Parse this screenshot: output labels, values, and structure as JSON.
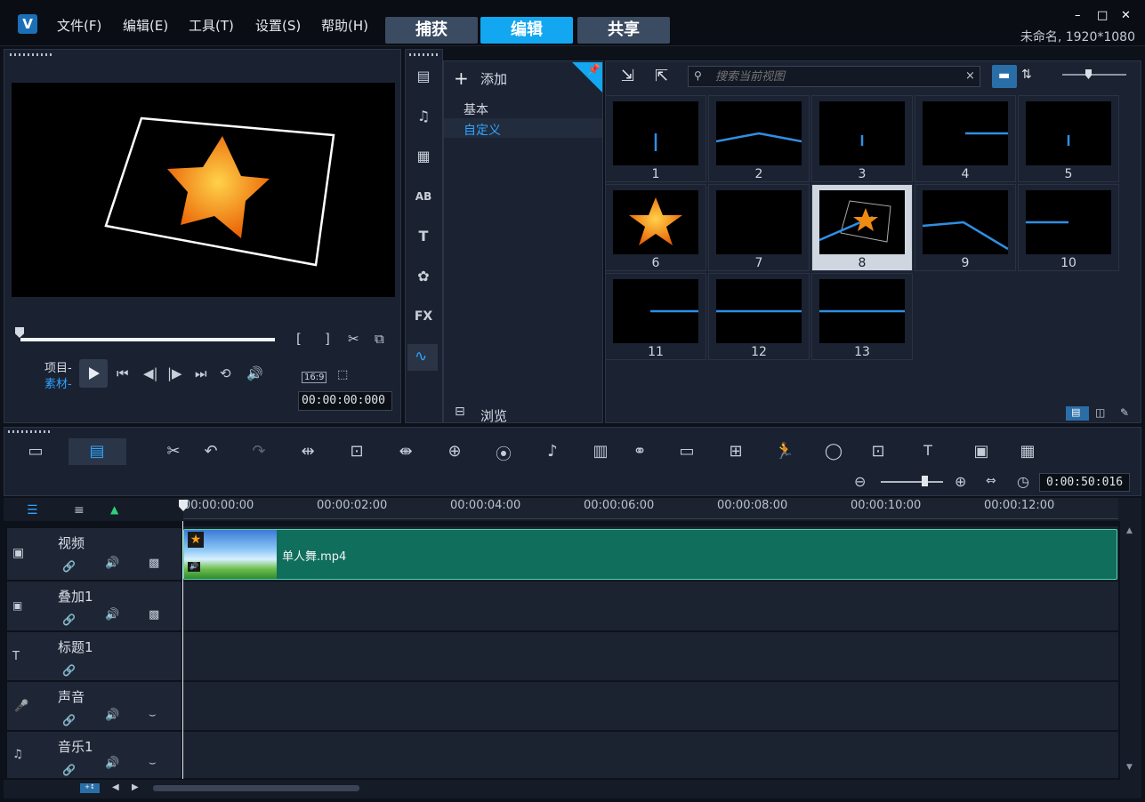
{
  "app": {
    "logo": "V",
    "project": "未命名, 1920*1080"
  },
  "menu": [
    "文件(F)",
    "编辑(E)",
    "工具(T)",
    "设置(S)",
    "帮助(H)"
  ],
  "tabs": [
    "捕获",
    "编辑",
    "共享"
  ],
  "window_controls": [
    "–",
    "□",
    "✕"
  ],
  "player": {
    "mode_project": "项目-",
    "mode_clip": "素材-",
    "timecode": "00:00:00:000",
    "aspect": "16:9",
    "play_icon": "play-icon"
  },
  "library": {
    "add_label": "添加",
    "categories": [
      "基本",
      "自定义"
    ],
    "browse_label": "浏览",
    "search_placeholder": "搜索当前视图",
    "search_clear": "×",
    "thumbs": [
      "1",
      "2",
      "3",
      "4",
      "5",
      "6",
      "7",
      "8",
      "9",
      "10",
      "11",
      "12",
      "13"
    ],
    "selected": "8"
  },
  "timeline": {
    "zoom_time": "0:00:50:016",
    "ruler": [
      "00:00:00:00",
      "00:00:02:00",
      "00:00:04:00",
      "00:00:06:00",
      "00:00:08:00",
      "00:00:10:00",
      "00:00:12:00"
    ],
    "tracks": [
      "视频",
      "叠加1",
      "标题1",
      "声音",
      "音乐1"
    ],
    "clip_name": "单人舞.mp4"
  },
  "colors": {
    "accent": "#12a7f0",
    "clip": "#0f6e5c",
    "line": "#2f8fe4"
  }
}
